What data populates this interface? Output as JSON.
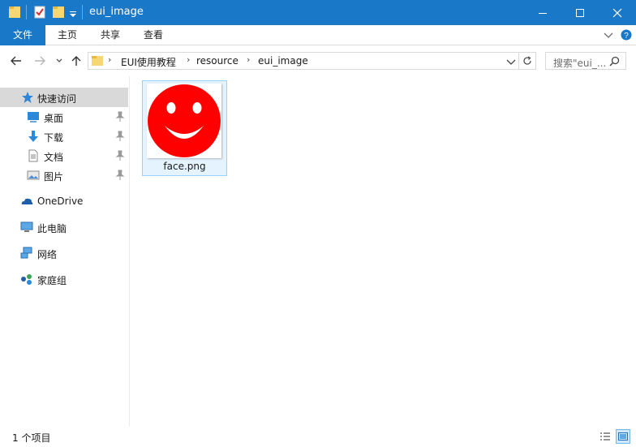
{
  "window": {
    "title": "eui_image",
    "controls": [
      "minimize-icon",
      "maximize-icon",
      "close-icon"
    ]
  },
  "quick_access_toolbar": [
    "folder-icon",
    "properties-icon",
    "new-folder-icon",
    "customize-dropdown-icon"
  ],
  "ribbon": {
    "tabs": [
      {
        "label": "文件"
      },
      {
        "label": "主页"
      },
      {
        "label": "共享"
      },
      {
        "label": "查看"
      }
    ]
  },
  "address": {
    "breadcrumbs": [
      "EUI使用教程",
      "resource",
      "eui_image"
    ],
    "search_placeholder": "搜索\"eui_..."
  },
  "navigation": {
    "quick_access": {
      "label": "快速访问",
      "icon": "star-icon"
    },
    "pinned": [
      {
        "label": "桌面",
        "icon": "desktop-icon"
      },
      {
        "label": "下载",
        "icon": "download-icon"
      },
      {
        "label": "文档",
        "icon": "document-icon"
      },
      {
        "label": "图片",
        "icon": "pictures-icon"
      }
    ],
    "roots": [
      {
        "label": "OneDrive",
        "icon": "onedrive-icon"
      },
      {
        "label": "此电脑",
        "icon": "computer-icon"
      },
      {
        "label": "网络",
        "icon": "network-icon"
      },
      {
        "label": "家庭组",
        "icon": "homegroup-icon"
      }
    ]
  },
  "files": [
    {
      "name": "face.png",
      "thumbnail": "smiley-face-icon",
      "selected": true
    }
  ],
  "colors": {
    "titlebar": "#1a78c9",
    "face_red": "#ff0000",
    "selection": "#e5f3ff"
  },
  "status": {
    "item_count": "1 个项目"
  }
}
